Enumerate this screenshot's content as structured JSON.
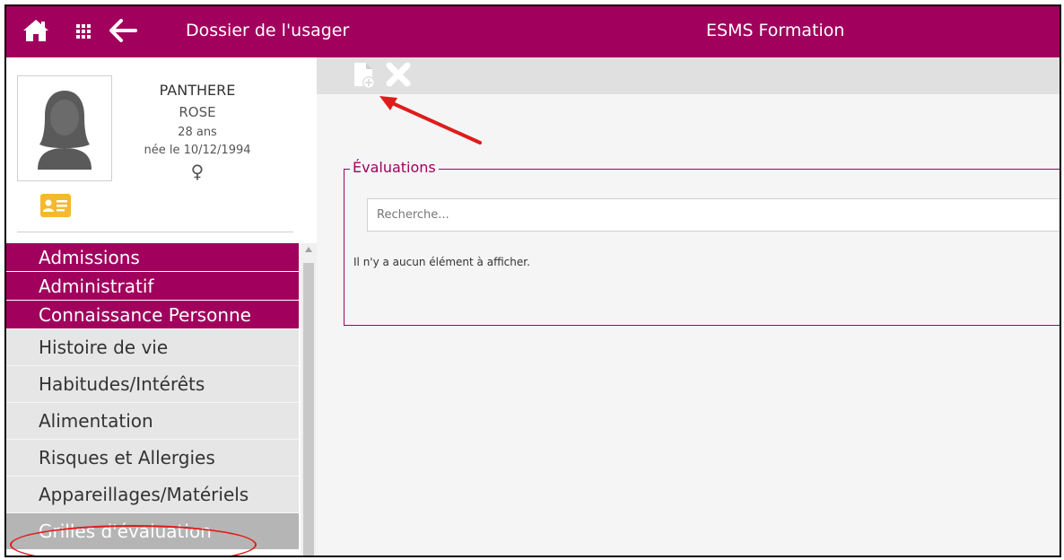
{
  "header": {
    "title": "Dossier de l'usager",
    "center_title": "ESMS Formation",
    "icons": [
      "home-icon",
      "apps-grid-icon",
      "back-arrow-icon"
    ]
  },
  "patient": {
    "last_name": "PANTHERE",
    "first_name": "ROSE",
    "age": "28 ans",
    "birth": "née le 10/12/1994",
    "sex_symbol": "♀"
  },
  "sidebar": {
    "items": [
      {
        "label": "Admissions",
        "kind": "primary"
      },
      {
        "label": "Administratif",
        "kind": "primary"
      },
      {
        "label": "Connaissance Personne",
        "kind": "primary"
      },
      {
        "label": "Histoire de vie",
        "kind": "secondary"
      },
      {
        "label": "Habitudes/Intérêts",
        "kind": "secondary"
      },
      {
        "label": "Alimentation",
        "kind": "secondary"
      },
      {
        "label": "Risques et Allergies",
        "kind": "secondary"
      },
      {
        "label": "Appareillages/Matériels",
        "kind": "secondary"
      },
      {
        "label": "Grilles d'évaluation",
        "kind": "active"
      }
    ]
  },
  "toolbar": {
    "icons": [
      "new-document-icon",
      "delete-icon"
    ]
  },
  "evaluations": {
    "legend": "Évaluations",
    "search_placeholder": "Recherche...",
    "empty_message": "Il n'y a aucun élément à afficher."
  },
  "colors": {
    "brand": "#a1015d",
    "id_card": "#f5b82e",
    "annotation": "#e01b1b"
  }
}
